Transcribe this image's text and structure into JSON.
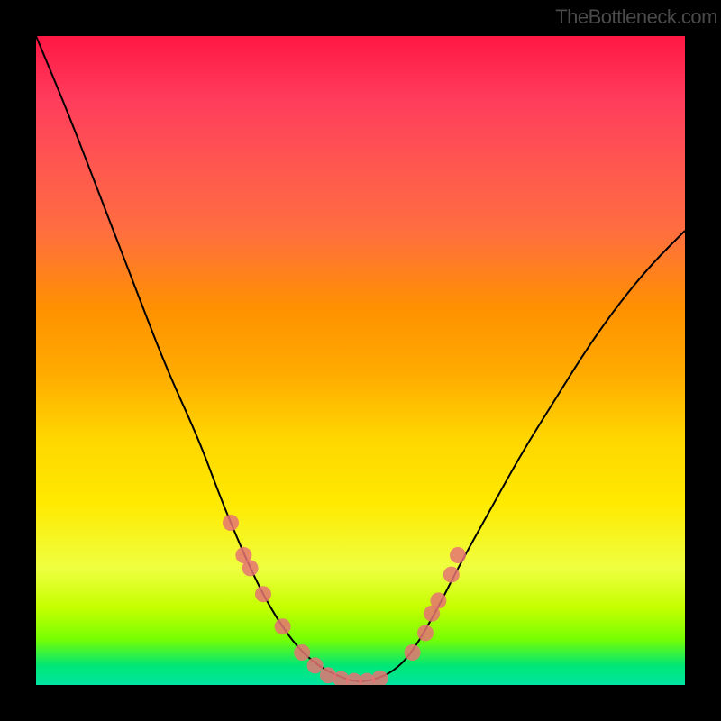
{
  "watermark": "TheBottleneck.com",
  "chart_data": {
    "type": "line",
    "title": "",
    "xlabel": "",
    "ylabel": "",
    "xlim": [
      0,
      100
    ],
    "ylim": [
      0,
      100
    ],
    "grid": false,
    "curve": {
      "name": "bottleneck-curve",
      "points": [
        {
          "x": 0,
          "y": 100
        },
        {
          "x": 5,
          "y": 88
        },
        {
          "x": 10,
          "y": 75
        },
        {
          "x": 15,
          "y": 62
        },
        {
          "x": 20,
          "y": 49
        },
        {
          "x": 25,
          "y": 38
        },
        {
          "x": 28,
          "y": 30
        },
        {
          "x": 30,
          "y": 25
        },
        {
          "x": 33,
          "y": 18
        },
        {
          "x": 36,
          "y": 12
        },
        {
          "x": 40,
          "y": 6
        },
        {
          "x": 44,
          "y": 2.5
        },
        {
          "x": 48,
          "y": 0.8
        },
        {
          "x": 50,
          "y": 0.5
        },
        {
          "x": 52,
          "y": 0.8
        },
        {
          "x": 55,
          "y": 2
        },
        {
          "x": 58,
          "y": 5
        },
        {
          "x": 62,
          "y": 12
        },
        {
          "x": 65,
          "y": 18
        },
        {
          "x": 70,
          "y": 27
        },
        {
          "x": 75,
          "y": 36
        },
        {
          "x": 80,
          "y": 44
        },
        {
          "x": 85,
          "y": 52
        },
        {
          "x": 90,
          "y": 59
        },
        {
          "x": 95,
          "y": 65
        },
        {
          "x": 100,
          "y": 70
        }
      ]
    },
    "markers": {
      "name": "highlighted-points",
      "color": "#e57373",
      "points": [
        {
          "x": 30,
          "y": 25
        },
        {
          "x": 32,
          "y": 20
        },
        {
          "x": 33,
          "y": 18
        },
        {
          "x": 35,
          "y": 14
        },
        {
          "x": 38,
          "y": 9
        },
        {
          "x": 41,
          "y": 5
        },
        {
          "x": 43,
          "y": 3
        },
        {
          "x": 45,
          "y": 1.5
        },
        {
          "x": 47,
          "y": 0.9
        },
        {
          "x": 49,
          "y": 0.6
        },
        {
          "x": 51,
          "y": 0.6
        },
        {
          "x": 53,
          "y": 1.0
        },
        {
          "x": 58,
          "y": 5
        },
        {
          "x": 60,
          "y": 8
        },
        {
          "x": 61,
          "y": 11
        },
        {
          "x": 62,
          "y": 13
        },
        {
          "x": 64,
          "y": 17
        },
        {
          "x": 65,
          "y": 20
        }
      ]
    },
    "background_gradient": {
      "top": "#ff1744",
      "upper_mid": "#ffab00",
      "lower_mid": "#ffea00",
      "bottom": "#00e676"
    }
  }
}
